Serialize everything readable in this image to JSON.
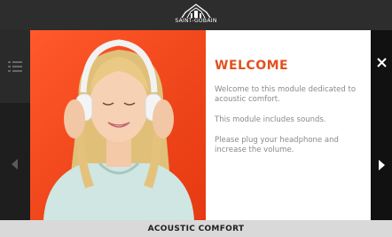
{
  "header": {
    "logo_text": "SAINT-GOBAIN"
  },
  "module": {
    "welcome_title": "WELCOME",
    "paragraphs": [
      "Welcome to this module dedicated to acoustic comfort.",
      "This module includes sounds.",
      "Please plug your headphone and increase the volume."
    ]
  },
  "footer": {
    "title": "ACOUSTIC COMFORT"
  },
  "icons": {
    "menu": "menu-icon",
    "previous": "chevron-left-icon",
    "next": "chevron-right-icon",
    "close": "close-icon"
  },
  "colors": {
    "accent": "#e2511f",
    "photo_background": "#f0461b",
    "topbar": "#2d2d2d",
    "bottombar": "#d9d9d9"
  }
}
